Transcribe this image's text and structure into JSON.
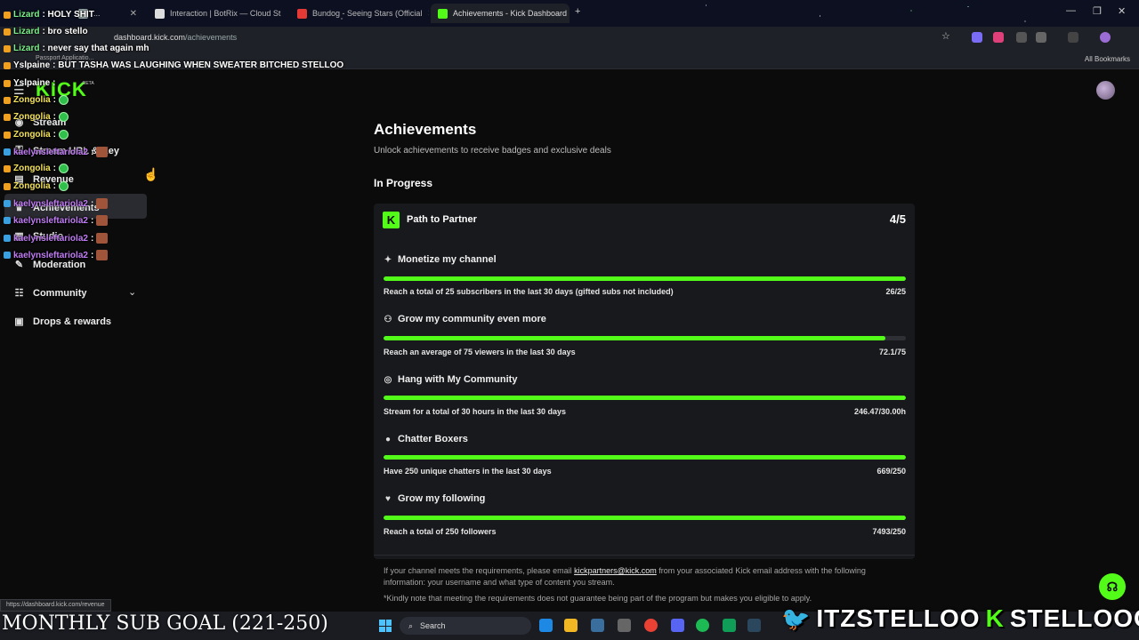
{
  "browser": {
    "tabs": [
      {
        "label": "...",
        "color": "#9aa"
      },
      {
        "label": "Interaction | BotRix — Cloud St",
        "color": "#ddd"
      },
      {
        "label": "Bundog - Seeing Stars (Official",
        "color": "#e53935"
      },
      {
        "label": "Achievements - Kick Dashboard",
        "color": "#53fc18"
      }
    ],
    "new_tab": "+",
    "url_host": "dashboard.kick.com",
    "url_path": "/achievements",
    "bookmark": "Passport Applicatio...",
    "all_bookmarks": "All Bookmarks",
    "win_min": "—",
    "win_max": "❐",
    "win_close": "✕"
  },
  "dashboard": {
    "logo": "KICK",
    "logo_beta": "BETA",
    "sidebar": [
      {
        "label": "Stream",
        "icon": "stream-icon",
        "glyph": "◉"
      },
      {
        "label": "Stream URL & Key",
        "icon": "key-icon",
        "glyph": "⚿"
      },
      {
        "label": "Revenue",
        "icon": "revenue-icon",
        "glyph": "▤"
      },
      {
        "label": "Achievements",
        "icon": "trophy-icon",
        "glyph": "♛"
      },
      {
        "label": "Studio",
        "icon": "studio-icon",
        "glyph": "▦"
      },
      {
        "label": "Moderation",
        "icon": "wrench-icon",
        "glyph": "✎"
      },
      {
        "label": "Community",
        "icon": "community-icon",
        "glyph": "☷"
      },
      {
        "label": "Drops & rewards",
        "icon": "gift-icon",
        "glyph": "▣"
      }
    ],
    "title": "Achievements",
    "subtitle": "Unlock achievements to receive badges and exclusive deals",
    "section": "In Progress",
    "card": {
      "badge": "K",
      "title": "Path to Partner",
      "count": "4/5",
      "achievements": [
        {
          "title": "Monetize my channel",
          "icon": "sparkle-icon",
          "glyph": "✦",
          "requirement": "Reach a total of 25 subscribers in the last 30 days (gifted subs not included)",
          "value": "26/25",
          "progress": 1.0
        },
        {
          "title": "Grow my community even more",
          "icon": "people-icon",
          "glyph": "⚇",
          "requirement": "Reach an average of 75 viewers in the last 30 days",
          "value": "72.1/75",
          "progress": 0.961
        },
        {
          "title": "Hang with My Community",
          "icon": "broadcast-icon",
          "glyph": "◎",
          "requirement": "Stream for a total of 30 hours in the last 30 days",
          "value": "246.47/30.00h",
          "progress": 1.0
        },
        {
          "title": "Chatter Boxers",
          "icon": "chat-icon",
          "glyph": "●",
          "requirement": "Have 250 unique chatters in the last 30 days",
          "value": "669/250",
          "progress": 1.0
        },
        {
          "title": "Grow my following",
          "icon": "heart-icon",
          "glyph": "♥",
          "requirement": "Reach a total of 250 followers",
          "value": "7493/250",
          "progress": 1.0
        }
      ]
    },
    "footer_pre": "If your channel meets the requirements, please email ",
    "footer_email": "kickpartners@kick.com",
    "footer_post": " from your associated Kick email address with the following information: your username and what type of content you stream.",
    "footer_note": "*Kindly note that meeting the requirements does not guarantee being part of the program but makes you eligible to apply.",
    "status_url": "https://dashboard.kick.com/revenue"
  },
  "chat": [
    {
      "name": "Lizard",
      "color": "#7cf08a",
      "text": ": HOLY SHIT",
      "emote": ""
    },
    {
      "name": "Lizard",
      "color": "#7cf08a",
      "text": ": bro stello",
      "emote": ""
    },
    {
      "name": "Lizard",
      "color": "#7cf08a",
      "text": ": never say that again mh",
      "emote": ""
    },
    {
      "name": "Yslpaine",
      "color": "#ffffff",
      "text": ": BUT TASHA WAS LAUGHING WHEN SWEATER BITCHED STELLOO",
      "emote": ""
    },
    {
      "name": "Yslpaine",
      "color": "#ffffff",
      "text": ":",
      "emote": ""
    },
    {
      "name": "Zongolia",
      "color": "#f2e15a",
      "text": ":",
      "emote": "gem"
    },
    {
      "name": "Zongolia",
      "color": "#f2e15a",
      "text": ":",
      "emote": "gem"
    },
    {
      "name": "Zongolia",
      "color": "#f2e15a",
      "text": ":",
      "emote": "gem"
    },
    {
      "name": "kaelynsleftariola2",
      "color": "#c07cf5",
      "text": ":",
      "emote": "pic"
    },
    {
      "name": "Zongolia",
      "color": "#f2e15a",
      "text": ":",
      "emote": "gem"
    },
    {
      "name": "Zongolia",
      "color": "#f2e15a",
      "text": ":",
      "emote": "gem"
    },
    {
      "name": "kaelynsleftariola2",
      "color": "#c07cf5",
      "text": ":",
      "emote": "pic"
    },
    {
      "name": "kaelynsleftariola2",
      "color": "#c07cf5",
      "text": ":",
      "emote": "pic"
    },
    {
      "name": "kaelynsleftariola2",
      "color": "#c07cf5",
      "text": ":",
      "emote": "pic"
    },
    {
      "name": "kaelynsleftariola2",
      "color": "#c07cf5",
      "text": ":",
      "emote": "pic"
    }
  ],
  "overlay": {
    "goal": "MONTHLY SUB GOAL (221-250)",
    "twitter": "ITZSTELLOO",
    "kick_handle": "STELLOOO",
    "kick_letter": "K"
  },
  "taskbar": {
    "search": "Search"
  }
}
